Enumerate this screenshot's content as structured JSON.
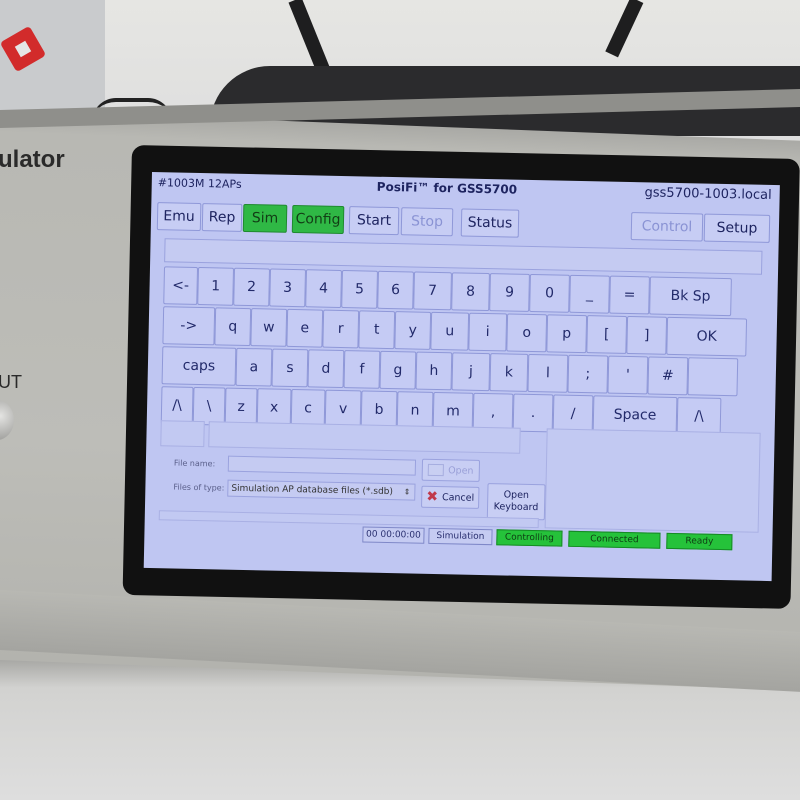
{
  "device": {
    "brand_partial": "ulator",
    "port_label_partial": "UT"
  },
  "screen": {
    "header": {
      "left": "#1003M  12APs",
      "title": "PosiFi™ for GSS5700",
      "host": "gss5700-1003.local"
    },
    "toolbar": [
      {
        "label": "Emu",
        "state": "normal"
      },
      {
        "label": "Rep",
        "state": "normal"
      },
      {
        "label": "Sim",
        "state": "active"
      },
      {
        "label": "Config",
        "state": "active"
      },
      {
        "label": "Start",
        "state": "normal"
      },
      {
        "label": "Stop",
        "state": "disabled"
      },
      {
        "label": "Status",
        "state": "normal"
      },
      {
        "label": "Control",
        "state": "disabled"
      },
      {
        "label": "Setup",
        "state": "normal"
      }
    ],
    "text_field": {
      "value": ""
    },
    "keyboard": {
      "rows": [
        [
          "<-",
          "1",
          "2",
          "3",
          "4",
          "5",
          "6",
          "7",
          "8",
          "9",
          "0",
          "_",
          "=",
          "Bk Sp"
        ],
        [
          "->",
          "q",
          "w",
          "e",
          "r",
          "t",
          "y",
          "u",
          "i",
          "o",
          "p",
          "[",
          "]",
          "OK"
        ],
        [
          "caps",
          "a",
          "s",
          "d",
          "f",
          "g",
          "h",
          "j",
          "k",
          "l",
          ";",
          "'",
          "#",
          ""
        ],
        [
          "/\\",
          "\\",
          "z",
          "x",
          "c",
          "v",
          "b",
          "n",
          "m",
          ",",
          ".",
          "/",
          "Space",
          "/\\"
        ]
      ]
    },
    "file_dialog": {
      "file_name_label": "File name:",
      "file_name_value": "",
      "files_of_type_label": "Files of type:",
      "files_of_type_value": "Simulation AP database files (*.sdb)",
      "open_button": "Open",
      "cancel_button": "Cancel",
      "open_keyboard_button": "Open Keyboard"
    },
    "status_bar": {
      "timer": "00 00:00:00",
      "mode": "Simulation",
      "controlling": "Controlling",
      "connected": "Connected",
      "ready": "Ready"
    },
    "colors": {
      "screen_bg": "#bfc6f2",
      "active_green": "#2fb845",
      "status_green": "#25c23a",
      "cancel_x": "#c0394b"
    }
  }
}
